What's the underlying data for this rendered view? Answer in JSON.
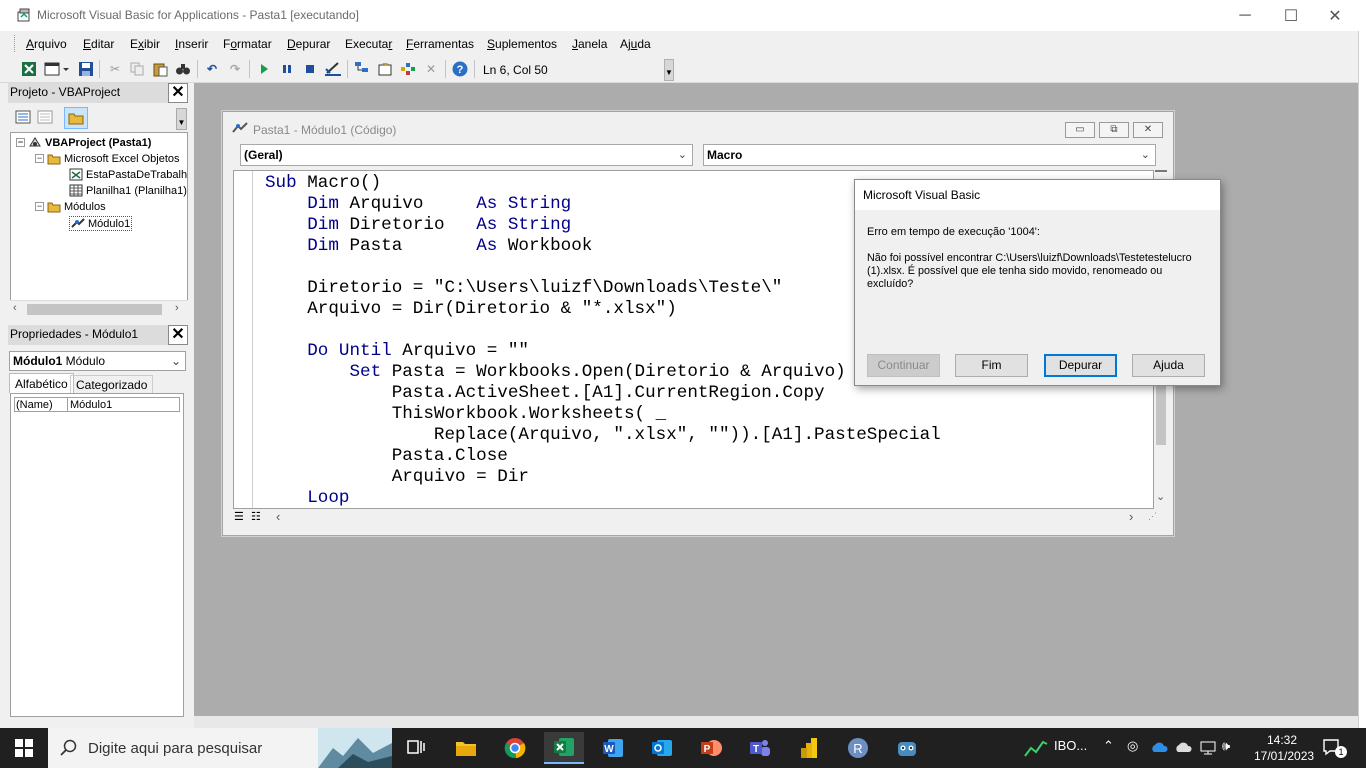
{
  "window": {
    "title": "Microsoft Visual Basic for Applications - Pasta1 [executando]",
    "minimize": "─",
    "maximize": "☐",
    "close": "✕"
  },
  "menu": [
    {
      "label": "Arquivo",
      "key": "A",
      "rest": "rquivo"
    },
    {
      "label": "Editar",
      "key": "E",
      "rest": "ditar"
    },
    {
      "label": "Exibir",
      "key": "x",
      "pre": "E",
      "rest": "ibir"
    },
    {
      "label": "Inserir",
      "key": "I",
      "rest": "nserir"
    },
    {
      "label": "Formatar",
      "key": "o",
      "pre": "F",
      "rest": "rmatar"
    },
    {
      "label": "Depurar",
      "key": "D",
      "rest": "epurar"
    },
    {
      "label": "Executar",
      "key": "r",
      "pre": "Executa",
      "rest": ""
    },
    {
      "label": "Ferramentas",
      "key": "F",
      "rest": "erramentas"
    },
    {
      "label": "Suplementos",
      "key": "S",
      "rest": "uplementos"
    },
    {
      "label": "Janela",
      "key": "J",
      "rest": "anela"
    },
    {
      "label": "Ajuda",
      "key": "u",
      "pre": "Aj",
      "rest": "da"
    }
  ],
  "toolbar": {
    "position": "Ln 6, Col 50"
  },
  "project": {
    "title": "Projeto - VBAProject",
    "root": "VBAProject (Pasta1)",
    "folder_objects": "Microsoft Excel Objetos",
    "item_workbook": "EstaPastaDeTrabalh",
    "item_sheet": "Planilha1 (Planilha1)",
    "folder_modules": "Módulos",
    "item_module": "Módulo1"
  },
  "properties": {
    "title": "Propriedades - Módulo1",
    "object_name": "Módulo1",
    "object_type": "Módulo",
    "tab_alpha": "Alfabético",
    "tab_cat": "Categorizado",
    "prop_name": "(Name)",
    "prop_value": "Módulo1"
  },
  "code_window": {
    "title": "Pasta1 - Módulo1 (Código)",
    "object_combo": "(Geral)",
    "proc_combo": "Macro",
    "lines": [
      [
        {
          "k": 1,
          "t": "Sub"
        },
        {
          "t": " Macro()"
        }
      ],
      [
        {
          "t": "    "
        },
        {
          "k": 1,
          "t": "Dim"
        },
        {
          "t": " Arquivo     "
        },
        {
          "k": 1,
          "t": "As"
        },
        {
          "t": " "
        },
        {
          "k": 1,
          "t": "String"
        }
      ],
      [
        {
          "t": "    "
        },
        {
          "k": 1,
          "t": "Dim"
        },
        {
          "t": " Diretorio   "
        },
        {
          "k": 1,
          "t": "As"
        },
        {
          "t": " "
        },
        {
          "k": 1,
          "t": "String"
        }
      ],
      [
        {
          "t": "    "
        },
        {
          "k": 1,
          "t": "Dim"
        },
        {
          "t": " Pasta       "
        },
        {
          "k": 1,
          "t": "As"
        },
        {
          "t": " Workbook"
        }
      ],
      [
        {
          "t": ""
        }
      ],
      [
        {
          "t": "    Diretorio = \"C:\\Users\\luizf\\Downloads\\Teste\\\""
        }
      ],
      [
        {
          "t": "    Arquivo = Dir(Diretorio & \"*.xlsx\")"
        }
      ],
      [
        {
          "t": ""
        }
      ],
      [
        {
          "t": "    "
        },
        {
          "k": 1,
          "t": "Do Until"
        },
        {
          "t": " Arquivo = \"\""
        }
      ],
      [
        {
          "t": "        "
        },
        {
          "k": 1,
          "t": "Set"
        },
        {
          "t": " Pasta = Workbooks.Open(Diretorio & Arquivo)"
        }
      ],
      [
        {
          "t": "            Pasta.ActiveSheet.[A1].CurrentRegion.Copy"
        }
      ],
      [
        {
          "t": "            ThisWorkbook.Worksheets( _"
        }
      ],
      [
        {
          "t": "                Replace(Arquivo, \".xlsx\", \"\")).[A1].PasteSpecial"
        }
      ],
      [
        {
          "t": "            Pasta.Close"
        }
      ],
      [
        {
          "t": "            Arquivo = Dir"
        }
      ],
      [
        {
          "t": "    "
        },
        {
          "k": 1,
          "t": "Loop"
        }
      ]
    ]
  },
  "dialog": {
    "title": "Microsoft Visual Basic",
    "error_title": "Erro em tempo de execução '1004':",
    "message": "Não foi possível encontrar C:\\Users\\luizf\\Downloads\\Testetestelucro (1).xlsx. É possível que ele tenha sido movido, renomeado ou excluído?",
    "btn_continue": "Continuar",
    "btn_end": "Fim",
    "btn_debug": "Depurar",
    "btn_help": "Ajuda"
  },
  "taskbar": {
    "search_placeholder": "Digite aqui para pesquisar",
    "ibov": "IBO...",
    "time": "14:32",
    "date": "17/01/2023",
    "notifications": "1"
  },
  "colors": {
    "keyword": "#00008b",
    "mdi_background": "#acacac",
    "dialog_default_border": "#0078d7"
  }
}
